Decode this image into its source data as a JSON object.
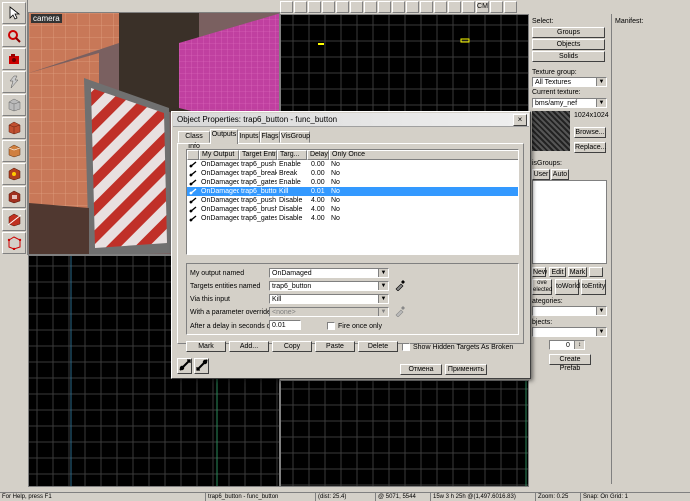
{
  "viewports": {
    "camera_label": "camera"
  },
  "topbar": {
    "buttons": [
      "",
      "",
      "",
      "",
      "",
      "",
      "",
      "",
      "",
      "",
      "",
      "",
      "",
      "",
      "CM",
      "",
      ""
    ]
  },
  "select_panel": {
    "title": "Select:",
    "groups_label": "Groups",
    "objects_label": "Objects",
    "solids_label": "Solids",
    "texture_group_label": "Texture group:",
    "texture_group_value": "All Textures",
    "current_texture_label": "Current texture:",
    "current_texture_value": "bms/amy_nef",
    "texture_size": "1024x1024",
    "browse_label": "Browse...",
    "replace_label": "Replace...",
    "visgroups_label": "isGroups:",
    "user_tab": "User",
    "auto_tab": "Auto",
    "new_label": "New",
    "edit_label": "Edit",
    "mark_label": "Mark",
    "move_selected_label": "ove\nelected",
    "to_world_label": "toWorld",
    "to_entity_label": "toEntity",
    "categories_label": "ategories:",
    "objects_label2": "bjects:",
    "spinner_value": "0",
    "create_prefab_label": "Create Prefab"
  },
  "manifest": {
    "title": "Manifest:"
  },
  "dialog": {
    "title": "Object Properties: trap6_button - func_button",
    "close": "×",
    "tabs": [
      "Class Info",
      "Outputs",
      "Inputs",
      "Flags",
      "VisGroup"
    ],
    "active_tab": 1,
    "columns": [
      "My Output",
      "Target Entity",
      "Targ...",
      "Delay",
      "Only Once"
    ],
    "rows": [
      {
        "output": "OnDamaged",
        "target": "trap6_push",
        "input": "Enable",
        "delay": "0.00",
        "once": "No",
        "selected": false
      },
      {
        "output": "OnDamaged",
        "target": "trap6_break",
        "input": "Break",
        "delay": "0.00",
        "once": "No",
        "selected": false
      },
      {
        "output": "OnDamaged",
        "target": "trap6_gates",
        "input": "Enable",
        "delay": "0.00",
        "once": "No",
        "selected": false
      },
      {
        "output": "OnDamaged",
        "target": "trap6_button",
        "input": "Kill",
        "delay": "0.01",
        "once": "No",
        "selected": true
      },
      {
        "output": "OnDamaged",
        "target": "trap6_push",
        "input": "Disable",
        "delay": "4.00",
        "once": "No",
        "selected": false
      },
      {
        "output": "OnDamaged",
        "target": "trap6_brush",
        "input": "Disable",
        "delay": "4.00",
        "once": "No",
        "selected": false
      },
      {
        "output": "OnDamaged",
        "target": "trap6_gates",
        "input": "Disable",
        "delay": "4.00",
        "once": "No",
        "selected": false
      }
    ],
    "form": {
      "output_label": "My output named",
      "output_value": "OnDamaged",
      "target_label": "Targets entities named",
      "target_value": "trap6_button",
      "input_label": "Via this input",
      "input_value": "Kill",
      "override_label": "With a parameter override of",
      "override_value": "<none>",
      "delay_label": "After a delay in seconds of",
      "delay_value": "0.01",
      "fire_once_label": "Fire once only"
    },
    "buttons": {
      "mark": "Mark",
      "add": "Add...",
      "copy": "Copy",
      "paste": "Paste",
      "delete": "Delete",
      "show_hidden": "Show Hidden Targets As Broken",
      "cancel": "Отмена",
      "apply": "Применить"
    }
  },
  "statusbar": {
    "left": "For Help, press F1",
    "entity": "trap6_button - func_button",
    "dist": "(dist: 25.4)",
    "coords": "@ 5071, 5544",
    "size": "15w 3 h 25h @(1,497.6016.83)",
    "zoom": "Zoom: 0.25",
    "snap": "Snap: On Grid: 1"
  }
}
